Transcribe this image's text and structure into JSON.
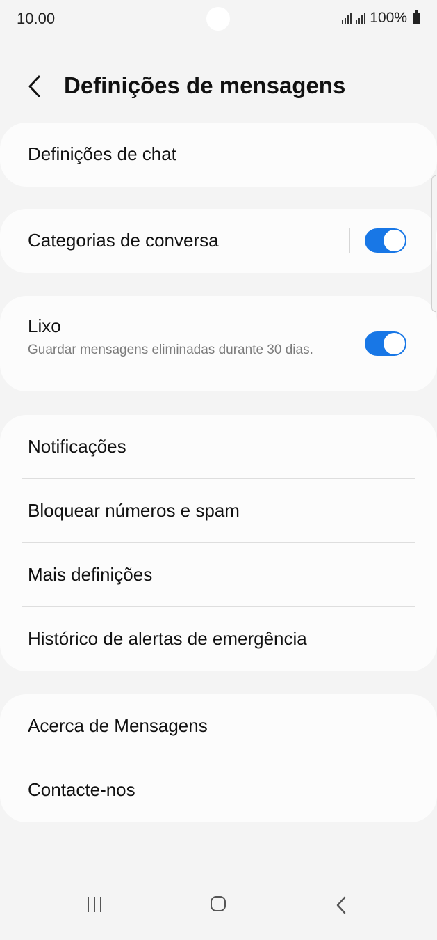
{
  "status_bar": {
    "time": "10.00",
    "battery": "100%"
  },
  "header": {
    "title": "Definições de mensagens"
  },
  "settings": {
    "chat_settings": "Definições de chat",
    "conversation_categories": {
      "label": "Categorias de conversa",
      "enabled": true
    },
    "trash": {
      "title": "Lixo",
      "subtitle": "Guardar mensagens eliminadas durante 30 dias.",
      "enabled": true
    },
    "group_main": [
      {
        "label": "Notificações"
      },
      {
        "label": "Bloquear números e spam"
      },
      {
        "label": "Mais definições"
      },
      {
        "label": "Histórico de alertas de emergência"
      }
    ],
    "group_about": [
      {
        "label": "Acerca de Mensagens"
      },
      {
        "label": "Contacte-nos"
      }
    ]
  },
  "colors": {
    "accent": "#1877e6",
    "background": "#f4f4f4",
    "card": "#fcfcfc"
  },
  "icons": {
    "back": "back-chevron-icon",
    "nav_recents": "recents-icon",
    "nav_home": "home-icon",
    "nav_back": "back-icon"
  }
}
